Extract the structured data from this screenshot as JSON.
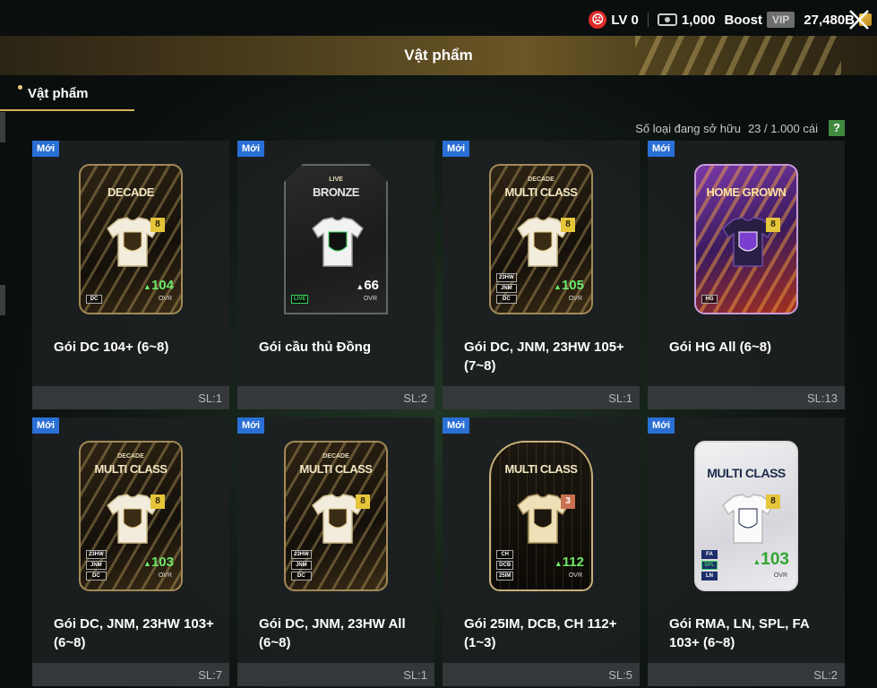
{
  "status": {
    "level_label": "LV 0",
    "coins": "1,000",
    "boost_label": "Boost",
    "vip_label": "VIP",
    "bp": "27,480B"
  },
  "header": {
    "title": "Vật phẩm"
  },
  "tabs": [
    {
      "label": "Vật phẩm",
      "active": true
    }
  ],
  "owned": {
    "label": "Số loại đang sở hữu",
    "count": "23 / 1.000 cái",
    "help": "?"
  },
  "new_label": "Mới",
  "items": [
    {
      "name": "Gói DC 104+ (6~8)",
      "qty": "SL:1",
      "card_title": "DECADE",
      "card_sub": "",
      "level": "8",
      "ovr": "104",
      "ovr_label": "OVR",
      "tags": [
        "DC"
      ],
      "emblem": "DC",
      "style": "gold"
    },
    {
      "name": "Gói cầu thủ Đồng",
      "qty": "SL:2",
      "card_title": "BRONZE",
      "card_sub": "LIVE",
      "level": "",
      "ovr": "66",
      "ovr_label": "OVR",
      "tags": [
        "LIVE"
      ],
      "emblem": "LIVE",
      "style": "bronze"
    },
    {
      "name": "Gói DC, JNM, 23HW 105+ (7~8)",
      "qty": "SL:1",
      "card_title": "MULTI CLASS",
      "card_sub": "DECADE",
      "level": "8",
      "ovr": "105",
      "ovr_label": "OVR",
      "tags": [
        "23HW",
        "JNM",
        "DC"
      ],
      "emblem": "DC",
      "style": "gold"
    },
    {
      "name": "Gói HG All (6~8)",
      "qty": "SL:13",
      "card_title": "HOME GROWN",
      "card_sub": "",
      "level": "8",
      "ovr": "",
      "ovr_label": "",
      "tags": [
        "HG"
      ],
      "emblem": "HG",
      "style": "purple"
    },
    {
      "name": "Gói DC, JNM, 23HW 103+ (6~8)",
      "qty": "SL:7",
      "card_title": "MULTI CLASS",
      "card_sub": "DECADE",
      "level": "8",
      "ovr": "103",
      "ovr_label": "OVR",
      "tags": [
        "23HW",
        "JNM",
        "DC"
      ],
      "emblem": "DC",
      "style": "gold"
    },
    {
      "name": "Gói DC, JNM, 23HW All (6~8)",
      "qty": "SL:1",
      "card_title": "MULTI CLASS",
      "card_sub": "DECADE",
      "level": "8",
      "ovr": "",
      "ovr_label": "",
      "tags": [
        "23HW",
        "JNM",
        "DC"
      ],
      "emblem": "DC",
      "style": "gold"
    },
    {
      "name": "Gói 25IM, DCB, CH 112+ (1~3)",
      "qty": "SL:5",
      "card_title": "MULTI CLASS",
      "card_sub": "",
      "level": "3",
      "ovr": "112",
      "ovr_label": "OVR",
      "tags": [
        "CH",
        "DCB",
        "25IM"
      ],
      "emblem": "IM",
      "style": "dark"
    },
    {
      "name": "Gói RMA, LN, SPL, FA 103+ (6~8)",
      "qty": "SL:2",
      "card_title": "MULTI CLASS",
      "card_sub": "",
      "level": "8",
      "ovr": "103",
      "ovr_label": "OVR",
      "tags": [
        "FA",
        "SPL",
        "LN"
      ],
      "emblem": "RMA",
      "style": "white"
    }
  ],
  "colors": {
    "accent_gold": "#d6b25a",
    "new_badge": "#2a6fd6",
    "ovr_green": "#6de86a",
    "help_green": "#3f8a3f"
  }
}
